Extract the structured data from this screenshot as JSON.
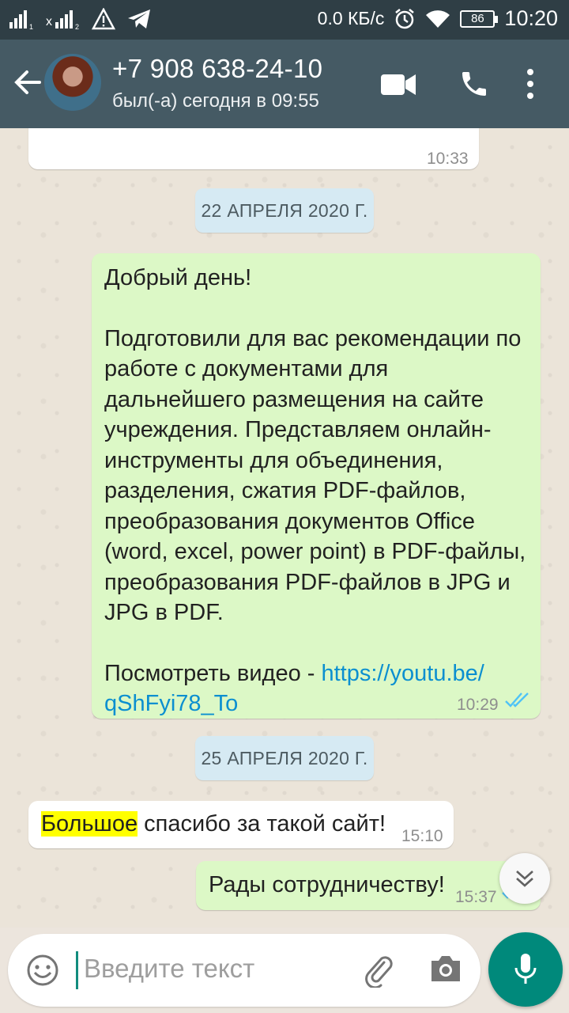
{
  "status_bar": {
    "speed": "0.0 КБ/с",
    "battery": "86",
    "time": "10:20",
    "icons": [
      "signal-1-icon",
      "signal-2-icon",
      "warning-icon",
      "telegram-icon",
      "alarm-icon",
      "wifi-icon",
      "battery-icon"
    ]
  },
  "header": {
    "contact_name": "+7 908 638-24-10",
    "last_seen": "был(-а) сегодня в 09:55",
    "icons": [
      "back-arrow-icon",
      "avatar",
      "video-call-icon",
      "phone-icon",
      "more-vert-icon"
    ]
  },
  "messages": {
    "prev_time": "10:33",
    "date1": "22 АПРЕЛЯ 2020 Г.",
    "msg1": {
      "line1": "Добрый день!",
      "line2": "Подготовили для вас рекомендации по",
      "line3": "работе с документами для",
      "line4": "дальнейшего размещения на сайте",
      "line5": "учреждения. Представляем онлайн-",
      "line6": "инструменты для объединения,",
      "line7": "разделения, сжатия PDF-файлов,",
      "line8": "преобразования документов Office",
      "line9": "(word, excel, power point) в PDF-файлы,",
      "line10": "преобразования PDF-файлов в JPG и",
      "line11": "JPG в PDF.",
      "video_prefix": "Посмотреть видео - ",
      "link_part1": "https://youtu.be/",
      "link_part2": "qShFyi78_To",
      "time": "10:29",
      "status": "read"
    },
    "date2": "25 АПРЕЛЯ 2020 Г.",
    "msg2": {
      "highlight": "Большое",
      "rest": " спасибо за такой сайт!",
      "time": "15:10"
    },
    "msg3": {
      "text": "Рады сотрудничеству!",
      "time": "15:37"
    }
  },
  "input": {
    "placeholder": "Введите текст"
  },
  "colors": {
    "appbar": "#455a64",
    "statusbar": "#2f3e45",
    "outgoing_bubble": "#dcf8c6",
    "incoming_bubble": "#ffffff",
    "link": "#0b8fd0",
    "read_ticks": "#4fc3f7",
    "mic_button": "#00897b",
    "highlight": "#ffff00"
  }
}
